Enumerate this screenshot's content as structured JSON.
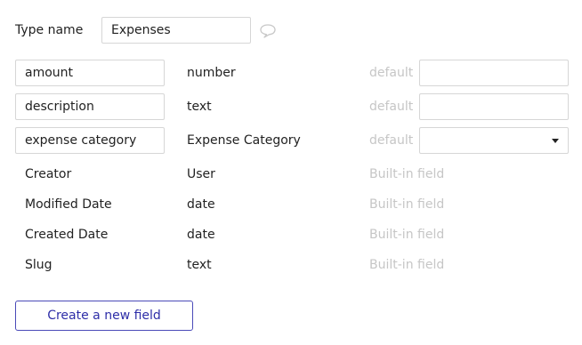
{
  "type_editor": {
    "type_name_label": "Type name",
    "type_name_value": "Expenses"
  },
  "fields": [
    {
      "name": "amount",
      "type": "number",
      "default_label": "default",
      "default_value": ""
    },
    {
      "name": "description",
      "type": "text",
      "default_label": "default",
      "default_value": ""
    },
    {
      "name": "expense category",
      "type": "Expense Category",
      "default_label": "default",
      "default_value": ""
    }
  ],
  "builtin_fields": [
    {
      "name": "Creator",
      "type": "User",
      "note": "Built-in field"
    },
    {
      "name": "Modified Date",
      "type": "date",
      "note": "Built-in field"
    },
    {
      "name": "Created Date",
      "type": "date",
      "note": "Built-in field"
    },
    {
      "name": "Slug",
      "type": "text",
      "note": "Built-in field"
    }
  ],
  "actions": {
    "create_field_label": "Create a new field"
  },
  "icons": {
    "comment": "speech-bubble-icon",
    "dropdown": "chevron-down-icon"
  },
  "colors": {
    "accent": "#2e2ea8",
    "muted_text": "#c6c6c6",
    "border": "#d6d6d6"
  }
}
